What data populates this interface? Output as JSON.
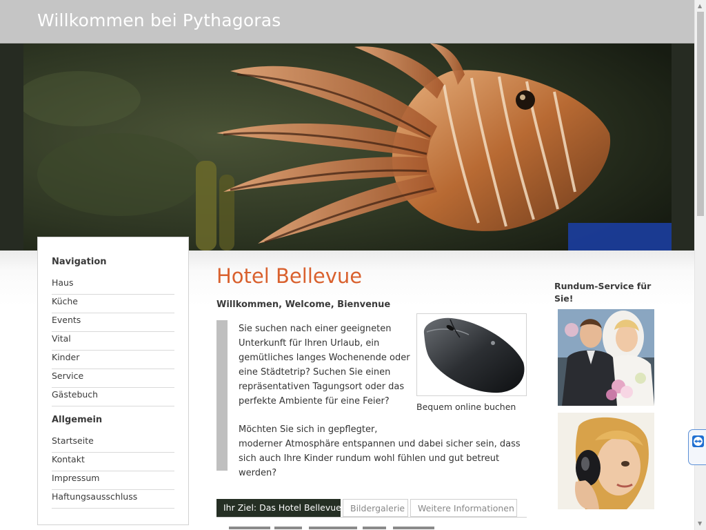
{
  "header": {
    "site_title": "Willkommen bei Pythagoras"
  },
  "hero": {
    "icon": "lionfish-image"
  },
  "nav": {
    "heading_navigation": "Navigation",
    "navigation_items": [
      "Haus",
      "Küche",
      "Events",
      "Vital",
      "Kinder",
      "Service",
      "Gästebuch"
    ],
    "heading_general": "Allgemein",
    "general_items": [
      "Startseite",
      "Kontakt",
      "Impressum",
      "Haftungsausschluss"
    ]
  },
  "main": {
    "title": "Hotel Bellevue",
    "subtitle": "Willkommen, Welcome, Bienvenue",
    "paragraph1": "Sie suchen nach einer geeigneten Unterkunft für Ihren Urlaub, ein gemütliches langes Wochenende oder eine Städtetrip? Suchen Sie einen repräsentativen Tagungsort oder das perfekte Ambiente für eine Feier?",
    "paragraph2_line1": "Möchten Sie sich in gepflegter,",
    "paragraph2_line2": "moderner Atmosphäre entspannen und dabei sicher sein, dass sich auch Ihre Kinder rundum wohl fühlen und gut betreut werden?",
    "image_caption": "Bequem online buchen",
    "tabs": [
      "Ihr Ziel: Das Hotel Bellevue",
      "Bildergalerie",
      "Weitere Informationen"
    ]
  },
  "sidebar": {
    "title": "Rundum-Service für Sie!"
  },
  "colors": {
    "accent": "#d9612e",
    "header_bg": "#c5c5c5",
    "tab_active_bg": "#252f24"
  }
}
